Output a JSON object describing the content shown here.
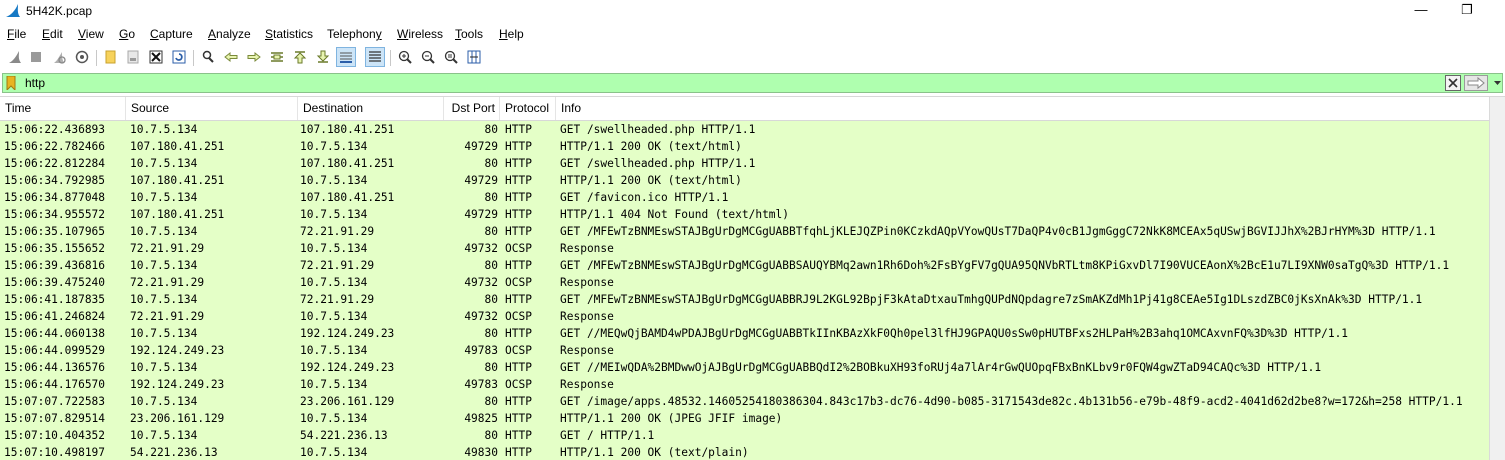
{
  "window": {
    "title": "5H42K.pcap",
    "minimize": "—",
    "maximize": "❐"
  },
  "menu": [
    {
      "key": "F",
      "rest": "ile"
    },
    {
      "key": "E",
      "rest": "dit"
    },
    {
      "key": "V",
      "rest": "iew"
    },
    {
      "key": "G",
      "rest": "o"
    },
    {
      "key": "C",
      "rest": "apture"
    },
    {
      "key": "A",
      "rest": "nalyze"
    },
    {
      "key": "S",
      "rest": "tatistics"
    },
    {
      "key": "",
      "rest": "Telephon",
      "key2": "y"
    },
    {
      "key": "W",
      "rest": "ireless"
    },
    {
      "key": "T",
      "rest": "ools"
    },
    {
      "key": "H",
      "rest": "elp"
    }
  ],
  "filter": {
    "value": "http"
  },
  "columns": {
    "time": "Time",
    "source": "Source",
    "destination": "Destination",
    "dst_port": "Dst Port",
    "protocol": "Protocol",
    "info": "Info"
  },
  "packets": [
    [
      "15:06:22.436893",
      "10.7.5.134",
      "107.180.41.251",
      "80",
      "HTTP",
      "GET /swellheaded.php HTTP/1.1"
    ],
    [
      "15:06:22.782466",
      "107.180.41.251",
      "10.7.5.134",
      "49729",
      "HTTP",
      "HTTP/1.1 200 OK  (text/html)"
    ],
    [
      "15:06:22.812284",
      "10.7.5.134",
      "107.180.41.251",
      "80",
      "HTTP",
      "GET /swellheaded.php HTTP/1.1"
    ],
    [
      "15:06:34.792985",
      "107.180.41.251",
      "10.7.5.134",
      "49729",
      "HTTP",
      "HTTP/1.1 200 OK  (text/html)"
    ],
    [
      "15:06:34.877048",
      "10.7.5.134",
      "107.180.41.251",
      "80",
      "HTTP",
      "GET /favicon.ico HTTP/1.1"
    ],
    [
      "15:06:34.955572",
      "107.180.41.251",
      "10.7.5.134",
      "49729",
      "HTTP",
      "HTTP/1.1 404 Not Found  (text/html)"
    ],
    [
      "15:06:35.107965",
      "10.7.5.134",
      "72.21.91.29",
      "80",
      "HTTP",
      "GET /MFEwTzBNMEswSTAJBgUrDgMCGgUABBTfqhLjKLEJQZPin0KCzkdAQpVYowQUsT7DaQP4v0cB1JgmGggC72NkK8MCEAx5qUSwjBGVIJJhX%2BJrHYM%3D HTTP/1.1"
    ],
    [
      "15:06:35.155652",
      "72.21.91.29",
      "10.7.5.134",
      "49732",
      "OCSP",
      "Response"
    ],
    [
      "15:06:39.436816",
      "10.7.5.134",
      "72.21.91.29",
      "80",
      "HTTP",
      "GET /MFEwTzBNMEswSTAJBgUrDgMCGgUABBSAUQYBMq2awn1Rh6Doh%2FsBYgFV7gQUA95QNVbRTLtm8KPiGxvDl7I90VUCEAonX%2BcE1u7LI9XNW0saTgQ%3D HTTP/1.1"
    ],
    [
      "15:06:39.475240",
      "72.21.91.29",
      "10.7.5.134",
      "49732",
      "OCSP",
      "Response"
    ],
    [
      "15:06:41.187835",
      "10.7.5.134",
      "72.21.91.29",
      "80",
      "HTTP",
      "GET /MFEwTzBNMEswSTAJBgUrDgMCGgUABBRJ9L2KGL92BpjF3kAtaDtxauTmhgQUPdNQpdagre7zSmAKZdMh1Pj41g8CEAe5Ig1DLszdZBC0jKsXnAk%3D HTTP/1.1"
    ],
    [
      "15:06:41.246824",
      "72.21.91.29",
      "10.7.5.134",
      "49732",
      "OCSP",
      "Response"
    ],
    [
      "15:06:44.060138",
      "10.7.5.134",
      "192.124.249.23",
      "80",
      "HTTP",
      "GET //MEQwQjBAMD4wPDAJBgUrDgMCGgUABBTkIInKBAzXkF0Qh0pel3lfHJ9GPAQU0sSw0pHUTBFxs2HLPaH%2B3ahq1OMCAxvnFQ%3D%3D HTTP/1.1"
    ],
    [
      "15:06:44.099529",
      "192.124.249.23",
      "10.7.5.134",
      "49783",
      "OCSP",
      "Response"
    ],
    [
      "15:06:44.136576",
      "10.7.5.134",
      "192.124.249.23",
      "80",
      "HTTP",
      "GET //MEIwQDA%2BMDwwOjAJBgUrDgMCGgUABBQdI2%2BOBkuXH93foRUj4a7lAr4rGwQUOpqFBxBnKLbv9r0FQW4gwZTaD94CAQc%3D HTTP/1.1"
    ],
    [
      "15:06:44.176570",
      "192.124.249.23",
      "10.7.5.134",
      "49783",
      "OCSP",
      "Response"
    ],
    [
      "15:07:07.722583",
      "10.7.5.134",
      "23.206.161.129",
      "80",
      "HTTP",
      "GET /image/apps.48532.14605254180386304.843c17b3-dc76-4d90-b085-3171543de82c.4b131b56-e79b-48f9-acd2-4041d62d2be8?w=172&h=258 HTTP/1.1"
    ],
    [
      "15:07:07.829514",
      "23.206.161.129",
      "10.7.5.134",
      "49825",
      "HTTP",
      "HTTP/1.1 200 OK  (JPEG JFIF image)"
    ],
    [
      "15:07:10.404352",
      "10.7.5.134",
      "54.221.236.13",
      "80",
      "HTTP",
      "GET / HTTP/1.1"
    ],
    [
      "15:07:10.498197",
      "54.221.236.13",
      "10.7.5.134",
      "49830",
      "HTTP",
      "HTTP/1.1 200 OK  (text/plain)"
    ]
  ],
  "colors": {
    "filter_bg": "#afffaf",
    "row_bg": "#e4ffc7",
    "accent": "#2f6fb5"
  },
  "toolbar_icons": [
    "shark-fin-start-icon",
    "stop-icon",
    "restart-icon",
    "capture-options-icon",
    "open-file-icon",
    "save-file-icon",
    "close-file-icon",
    "reload-file-icon",
    "find-packet-icon",
    "go-back-icon",
    "go-forward-icon",
    "go-to-packet-icon",
    "first-packet-icon",
    "last-packet-icon",
    "autoscroll-icon",
    "colorize-icon",
    "zoom-in-icon",
    "zoom-out-icon",
    "zoom-normal-icon",
    "resize-columns-icon"
  ]
}
